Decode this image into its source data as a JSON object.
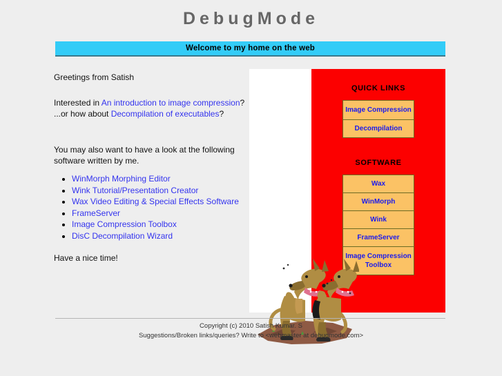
{
  "site": {
    "title": "DebugMode",
    "background_color": "#eeeeee"
  },
  "banner": {
    "text": "Welcome to my home on the web",
    "background_color": "#33ccf7",
    "border_color": "#3a7a8c"
  },
  "main": {
    "greeting": "Greetings from Satish",
    "interest_prefix": "Interested in ",
    "interest_link": "An introduction to image compression",
    "interest_suffix": "?",
    "alt_prefix": "...or how about ",
    "alt_link": "Decompilation of executables",
    "alt_suffix": "?",
    "software_intro_line1": "You may also want to have a look at the following",
    "software_intro_line2": "software written by me.",
    "software_links": [
      "WinMorph Morphing Editor",
      "Wink Tutorial/Presentation Creator",
      "Wax Video Editing & Special Effects Software",
      "FrameServer",
      "Image Compression Toolbox",
      "DisC Decompilation Wizard"
    ],
    "closing": "Have a nice time!",
    "link_color": "#3333ee"
  },
  "illustration": {
    "name": "two-dogs-on-dirt-mound",
    "white_panel_color": "#ffffff",
    "dog_body_color": "#b08d43",
    "dog_shade_color": "#8a6d2f",
    "collar_color": "#e87a9a",
    "dirt_color": "#8e5a44",
    "sprout_color": "#4a9a3a"
  },
  "sidebar": {
    "background_color": "#fc0000",
    "button_background": "#fbc265",
    "button_text_color": "#1a1aee",
    "button_border_color": "#6b6b23",
    "quick_links_heading": "QUICK LINKS",
    "quick_links": [
      "Image Compression",
      "Decompilation"
    ],
    "software_heading": "SOFTWARE",
    "software_buttons": [
      "Wax",
      "WinMorph",
      "Wink",
      "FrameServer",
      "Image Compression Toolbox"
    ]
  },
  "footer": {
    "copyright": "Copyright (c) 2010 Satish Kumar. S",
    "contact": "Suggestions/Broken links/queries? Write to <webmaster at debugmode.com>"
  }
}
